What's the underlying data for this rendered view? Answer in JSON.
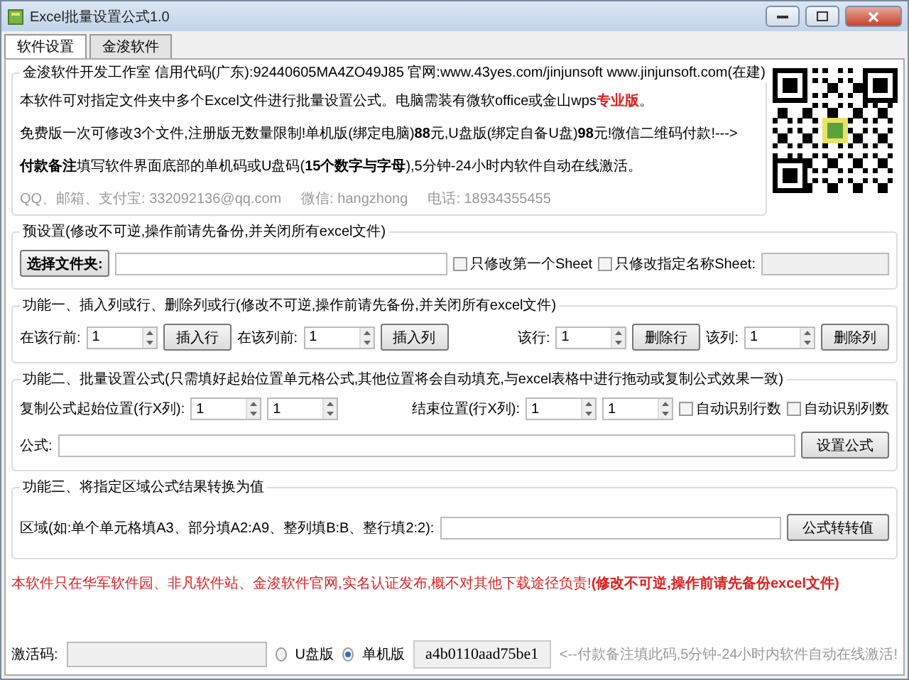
{
  "window": {
    "title": "Excel批量设置公式1.0"
  },
  "tabs": [
    {
      "label": "软件设置",
      "selected": true
    },
    {
      "label": "金浚软件",
      "selected": false
    }
  ],
  "info": {
    "legend": "金浚软件开发工作室 信用代码(广东):92440605MA4ZO49J85 官网:www.43yes.com/jinjunsoft  www.jinjunsoft.com(在建)",
    "lines": [
      {
        "text": "本软件可对指定文件夹中多个Excel文件进行批量设置公式。电脑需装有微软office或金山wps",
        "highlight": "专业版",
        "tail": "。"
      },
      {
        "text": "免费版一次可修改3个文件,注册版无数量限制!单机版(绑定电脑)**88**元,U盘版(绑定自备U盘)**98**元!微信二维码付款!--->"
      },
      {
        "text": "**付款备注**填写软件界面底部的单机码或U盘码(**15个数字与字母**),5分钟-24小时内软件自动在线激活。"
      }
    ],
    "contacts": [
      "QQ、邮箱、支付宝: 332092136@qq.com",
      "微信: hangzhong",
      "电话: 18934355455"
    ]
  },
  "preset": {
    "title": "预设置(修改不可逆,操作前请先备份,并关闭所有excel文件)",
    "button": "选择文件夹:",
    "checkboxes": [
      {
        "label": "只修改第一个Sheet",
        "checked": false
      },
      {
        "label": "只修改指定名称Sheet:",
        "checked": false
      }
    ],
    "sheet_name_field": {
      "disabled": true
    }
  },
  "insert": {
    "title": "功能一、插入列或行、删除列或行(修改不可逆,操作前请先备份,并关闭所有excel文件)",
    "items": [
      {
        "label": "在该行前:",
        "value": "1",
        "button": "插入行"
      },
      {
        "label": "在该列前:",
        "value": "1",
        "button": "插入列"
      },
      {
        "label": "该行:",
        "value": "1",
        "button": "删除行"
      },
      {
        "label": "该列:",
        "value": "1",
        "button": "删除列"
      }
    ]
  },
  "formula": {
    "title": "功能二、批量设置公式(只需填好起始位置单元格公式,其他位置将会自动填充,与excel表格中进行拖动或复制公式效果一致)",
    "start_label": "复制公式起始位置(行X列):",
    "start": [
      "1",
      "1"
    ],
    "end_label": "结束位置(行X列):",
    "end": [
      "1",
      "1"
    ],
    "checkboxes": [
      {
        "label": "自动识别行数",
        "checked": false
      },
      {
        "label": "自动识别列数",
        "checked": false
      }
    ],
    "formula_label": "公式:",
    "button": "设置公式"
  },
  "convert": {
    "title": "功能三、将指定区域公式结果转换为值",
    "label": "区域(如:单个单元格填A3、部分填A2:A9、整列填B:B、整行填2:2):",
    "button": "公式转转值"
  },
  "warning": "本软件只在华军软件园、非凡软件站、金浚软件官网,实名认证发布,概不对其他下载途径负责!**(修改不可逆,操作前请先备份excel文件)**",
  "activation": {
    "label": "激活码:",
    "radios": [
      {
        "label": "U盘版",
        "selected": false
      },
      {
        "label": "单机版",
        "selected": true
      }
    ],
    "machine_code": "a4b0110aad75be1",
    "hint": "<--付款备注填此码,5分钟-24小时内软件自动在线激活!"
  }
}
